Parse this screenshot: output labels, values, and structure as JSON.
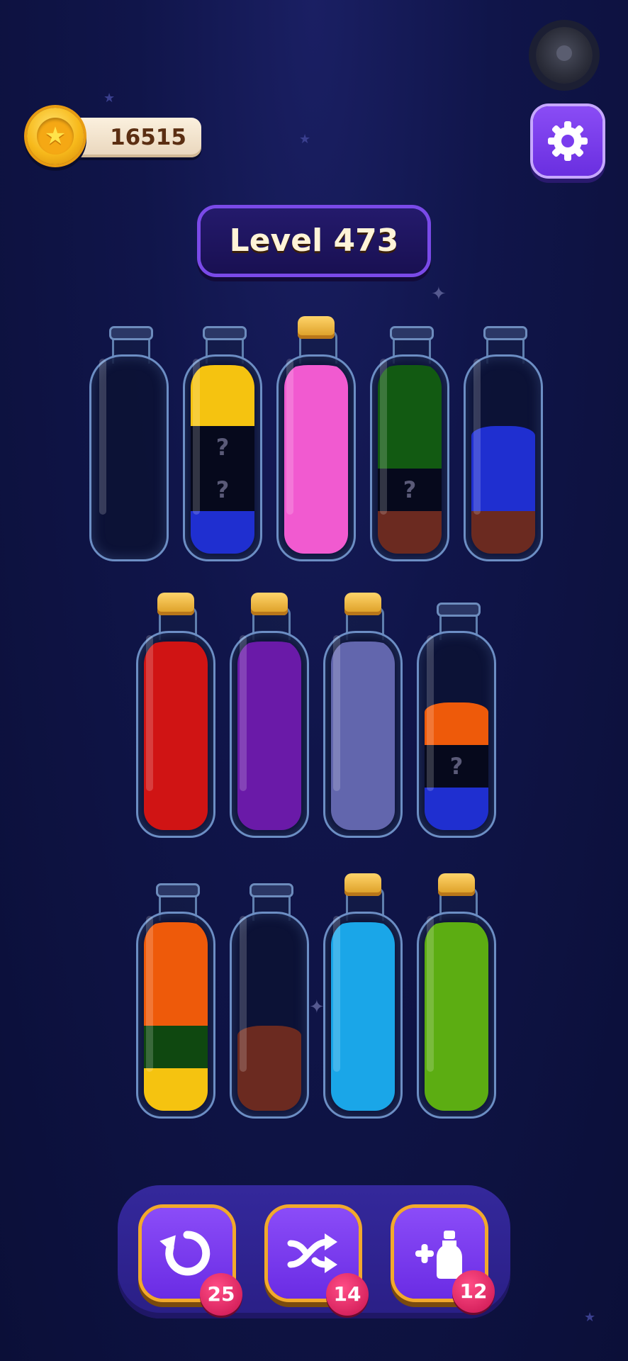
{
  "coins": {
    "value": "16515",
    "icon": "star-coin-icon"
  },
  "settings": {
    "icon": "gear-icon"
  },
  "level": {
    "label": "Level 473"
  },
  "colors": {
    "yellow": "#f5c310",
    "blue": "#1f2fd0",
    "pink": "#f15ad0",
    "green": "#125a12",
    "brown": "#6b2a20",
    "mystery": "#06091c",
    "red": "#d01414",
    "purple": "#6a1aa8",
    "lavender": "#6266ad",
    "orange": "#ee5a0a",
    "darkgreen": "#0f4810",
    "cyan": "#1aa6e8",
    "lime": "#5cad12"
  },
  "bottles": [
    {
      "row": 1,
      "corked": false,
      "layers": []
    },
    {
      "row": 1,
      "corked": false,
      "layers": [
        "blue",
        "mystery",
        "mystery",
        "yellow"
      ]
    },
    {
      "row": 1,
      "corked": true,
      "layers": [
        "pink",
        "pink",
        "pink",
        "pink"
      ]
    },
    {
      "row": 1,
      "corked": false,
      "layers": [
        "brown",
        "mystery",
        "green",
        "green"
      ]
    },
    {
      "row": 1,
      "corked": false,
      "layers": [
        "brown",
        "blue",
        "blue"
      ]
    },
    {
      "row": 2,
      "corked": true,
      "layers": [
        "red",
        "red",
        "red",
        "red"
      ]
    },
    {
      "row": 2,
      "corked": true,
      "layers": [
        "purple",
        "purple",
        "purple",
        "purple"
      ]
    },
    {
      "row": 2,
      "corked": true,
      "layers": [
        "lavender",
        "lavender",
        "lavender",
        "lavender"
      ]
    },
    {
      "row": 2,
      "corked": false,
      "layers": [
        "blue",
        "mystery",
        "orange"
      ]
    },
    {
      "row": 3,
      "corked": false,
      "layers": [
        "yellow",
        "darkgreen",
        "orange",
        "orange"
      ]
    },
    {
      "row": 3,
      "corked": false,
      "layers": [
        "brown",
        "brown"
      ]
    },
    {
      "row": 3,
      "corked": true,
      "layers": [
        "cyan",
        "cyan",
        "cyan",
        "cyan"
      ]
    },
    {
      "row": 3,
      "corked": true,
      "layers": [
        "lime",
        "lime",
        "lime",
        "lime"
      ]
    }
  ],
  "mystery_label": "?",
  "tools": [
    {
      "name": "undo",
      "icon": "undo-icon",
      "count": "25"
    },
    {
      "name": "shuffle",
      "icon": "shuffle-icon",
      "count": "14"
    },
    {
      "name": "add-bottle",
      "icon": "add-bottle-icon",
      "count": "12"
    }
  ]
}
